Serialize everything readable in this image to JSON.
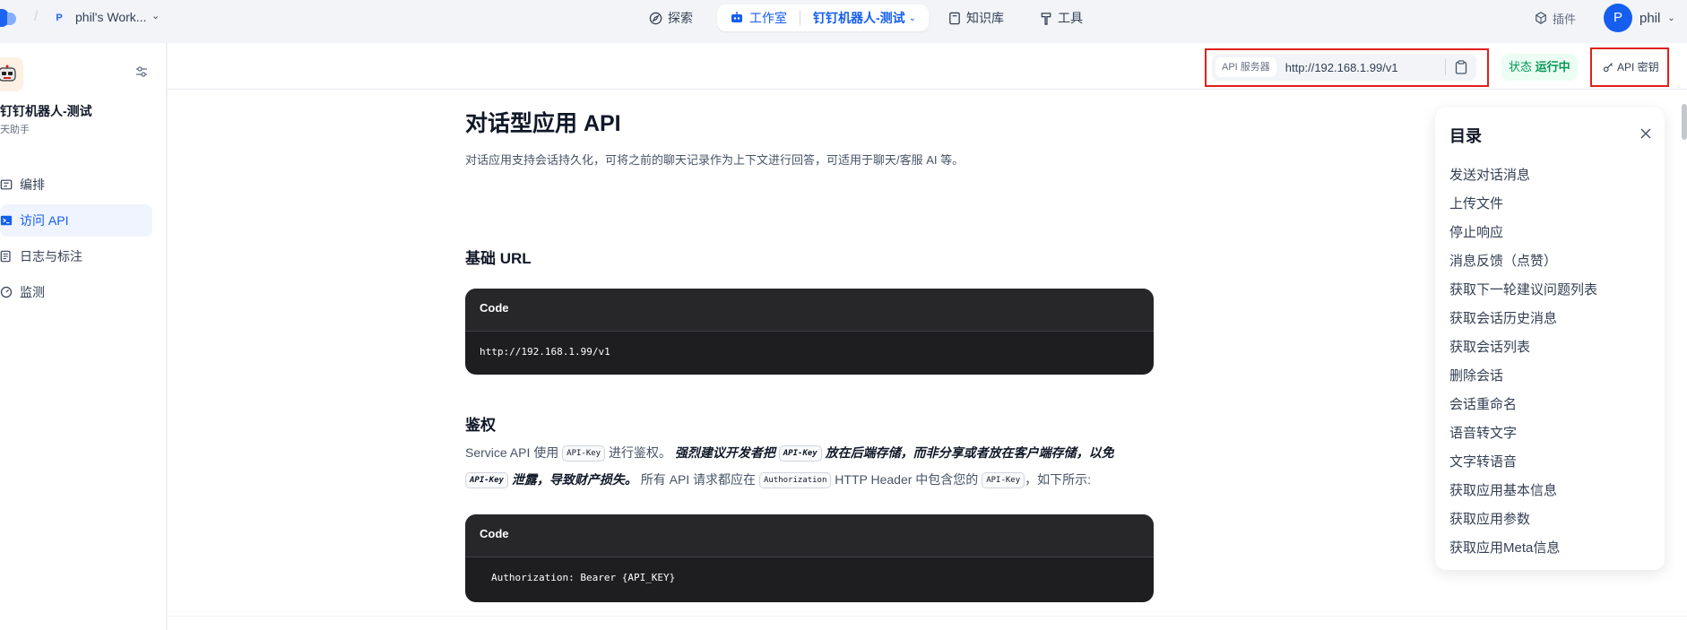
{
  "topnav": {
    "workspace_initial": "P",
    "workspace_name": "phil's Work...",
    "explore_label": "探索",
    "studio_label": "工作室",
    "current_app": "钉钉机器人-测试",
    "knowledge_label": "知识库",
    "tools_label": "工具",
    "plugins_label": "插件",
    "user_initial": "P",
    "user_name": "phil"
  },
  "sidebar": {
    "app_title": "钉钉机器人-测试",
    "app_subtitle": "天助手",
    "items": [
      {
        "label": "编排",
        "icon": "orchestrate-icon"
      },
      {
        "label": "访问 API",
        "icon": "terminal-icon"
      },
      {
        "label": "日志与标注",
        "icon": "log-icon"
      },
      {
        "label": "监测",
        "icon": "monitor-icon"
      }
    ],
    "active_index": 1
  },
  "subbar": {
    "api_server_label": "API 服务器",
    "api_url": "http://192.168.1.99/v1",
    "status_key": "状态",
    "status_value": "运行中",
    "api_key_label": "API 密钥"
  },
  "doc": {
    "title": "对话型应用 API",
    "intro": "对话应用支持会话持久化，可将之前的聊天记录作为上下文进行回答，可适用于聊天/客服 AI 等。",
    "base_url_heading": "基础 URL",
    "code1_header": "Code",
    "code1_body": "http://192.168.1.99/v1",
    "auth_heading": "鉴权",
    "auth_text": {
      "t1": "Service API 使用 ",
      "pill_apikey": "API-Key",
      "t2": " 进行鉴权。 ",
      "em1": "强烈建议开发者把 ",
      "em2": " 放在后端存储，而非分享或者放在客户端存储，以免 ",
      "em3": " 泄露，导致财产损失。",
      "t3": " 所有 API 请求都应在 ",
      "pill_auth": "Authorization",
      "t4": " HTTP Header 中包含您的 ",
      "t5": "，如下所示:"
    },
    "code2_header": "Code",
    "code2_body": "Authorization: Bearer {API_KEY}"
  },
  "toc": {
    "title": "目录",
    "items": [
      "发送对话消息",
      "上传文件",
      "停止响应",
      "消息反馈（点赞）",
      "获取下一轮建议问题列表",
      "获取会话历史消息",
      "获取会话列表",
      "删除会话",
      "会话重命名",
      "语音转文字",
      "文字转语音",
      "获取应用基本信息",
      "获取应用参数",
      "获取应用Meta信息"
    ]
  },
  "colors": {
    "accent": "#155eef",
    "status_green": "#039855",
    "highlight_red": "#e0201c"
  }
}
